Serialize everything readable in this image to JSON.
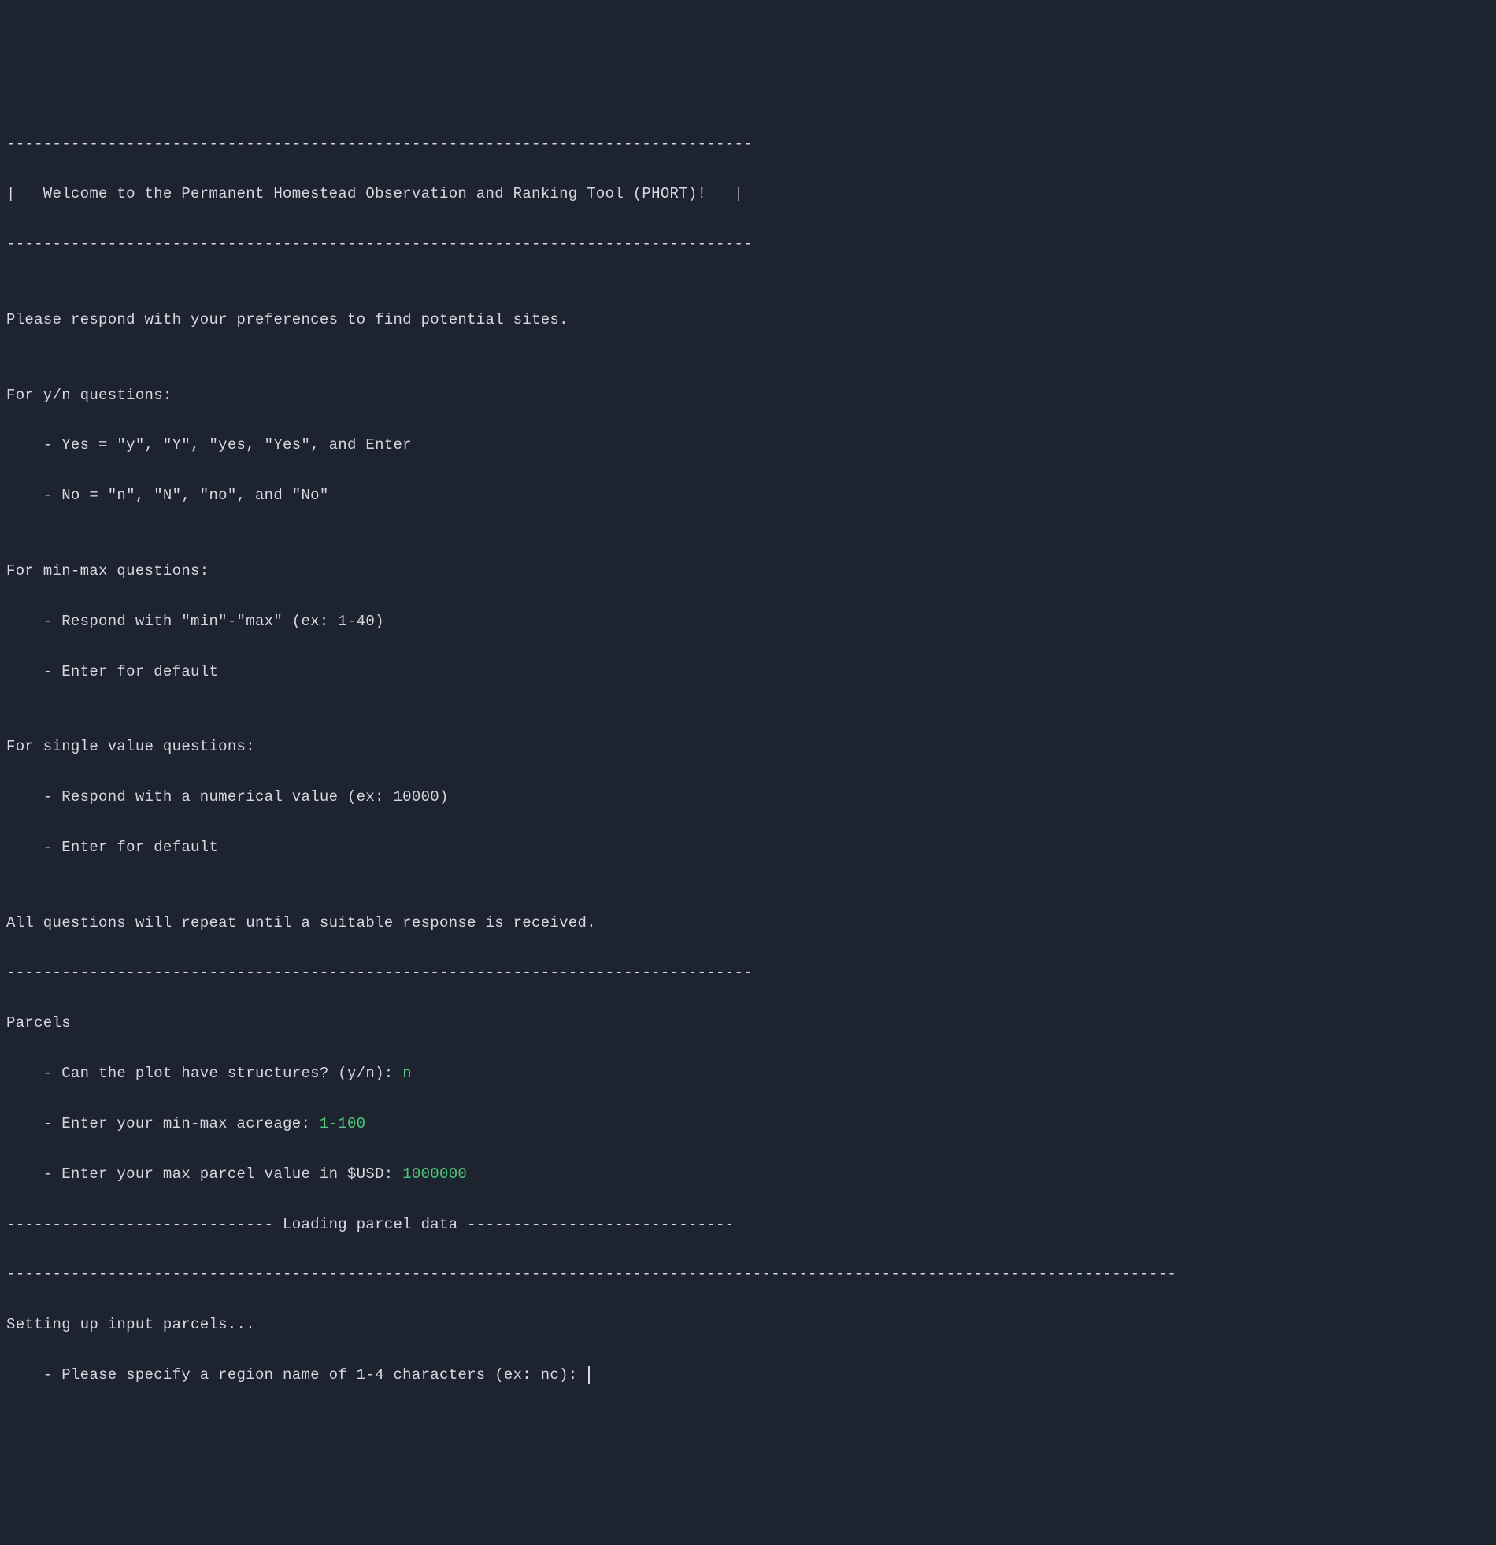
{
  "banner": {
    "rule_top": "---------------------------------------------------------------------------------",
    "title_line": "|   Welcome to the Permanent Homestead Observation and Ranking Tool (PHORT)!   |",
    "rule_bottom": "---------------------------------------------------------------------------------"
  },
  "intro": {
    "blank1": "",
    "prefs_line": "Please respond with your preferences to find potential sites.",
    "blank2": ""
  },
  "yn_section": {
    "header": "For y/n questions:",
    "bullet1": "    - Yes = \"y\", \"Y\", \"yes, \"Yes\", and Enter",
    "bullet2": "    - No = \"n\", \"N\", \"no\", and \"No\"",
    "blank": ""
  },
  "minmax_section": {
    "header": "For min-max questions:",
    "bullet1": "    - Respond with \"min\"-\"max\" (ex: 1-40)",
    "bullet2": "    - Enter for default",
    "blank": ""
  },
  "single_section": {
    "header": "For single value questions:",
    "bullet1": "    - Respond with a numerical value (ex: 10000)",
    "bullet2": "    - Enter for default",
    "blank": ""
  },
  "repeat_line": "All questions will repeat until a suitable response is received.",
  "parcels": {
    "rule": "---------------------------------------------------------------------------------",
    "header": "Parcels",
    "q1_prompt": "    - Can the plot have structures? (y/n): ",
    "q1_answer": "n",
    "q2_prompt": "    - Enter your min-max acreage: ",
    "q2_answer": "1-100",
    "q3_prompt": "    - Enter your max parcel value in $USD: ",
    "q3_answer": "1000000"
  },
  "loading": {
    "line": "----------------------------- Loading parcel data -----------------------------"
  },
  "setup": {
    "rule": "-------------------------------------------------------------------------------------------------------------------------------",
    "header": "Setting up input parcels...",
    "q1_prompt": "    - Please specify a region name of 1-4 characters (ex: nc): "
  }
}
